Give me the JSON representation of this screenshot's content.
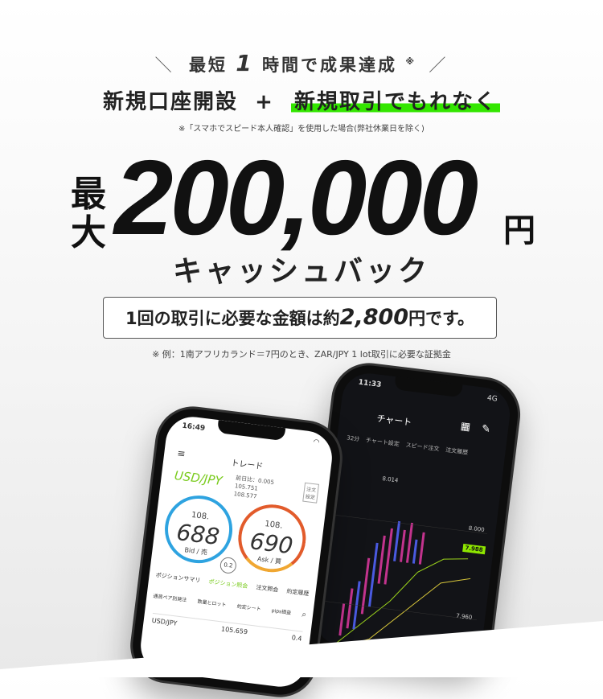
{
  "promo": {
    "eyebrow_pre": "最短",
    "eyebrow_num": "1",
    "eyebrow_post": "時間で成果達成",
    "eyebrow_mark": "※",
    "line2_a": "新規口座開設",
    "line2_plus": "+",
    "line2_b": "新規取引でもれなく",
    "note1": "※「スマホでスピード本人確認」を使用した場合(弊社休業日を除く)",
    "big_lead": "最大",
    "big_amount": "200,000",
    "big_unit": "円",
    "cashback": "キャッシュバック",
    "box_pre": "1回の取引に必要な金額は約",
    "box_value": "2,800",
    "box_post": "円です。",
    "note2": "※ 例：1南アフリカランド＝7円のとき、ZAR/JPY 1 lot取引に必要な証拠金"
  },
  "phone_back": {
    "time": "11:33",
    "signal": "4G",
    "title": "チャート",
    "tabs": [
      "32分",
      "チャート設定",
      "スピード注文",
      "注文履歴"
    ],
    "price_upper": "8.000",
    "price_tag": "7.988",
    "price_lower": "7.960",
    "price_top": "8.014"
  },
  "phone_front": {
    "time": "16:49",
    "title": "トレード",
    "pair": "USD/JPY",
    "info_a": "前日比：0.005",
    "info_b": "105.751",
    "info_c": "108.577",
    "side_label": "注文設定",
    "bid_top": "108.",
    "bid_mid": "688",
    "bid_label": "Bid / 売",
    "ask_top": "108.",
    "ask_mid": "690",
    "ask_label": "Ask / 買",
    "spread": "0.2",
    "tabs": [
      "ポジションサマリ",
      "ポジション照会",
      "注文照会",
      "約定履歴"
    ],
    "grid": [
      "通貨ペア別発注",
      "数量とロット",
      "約定シート",
      "pips損益"
    ],
    "row_pair": "USD/JPY",
    "row_val": "105.659",
    "row_end": "0.4"
  }
}
